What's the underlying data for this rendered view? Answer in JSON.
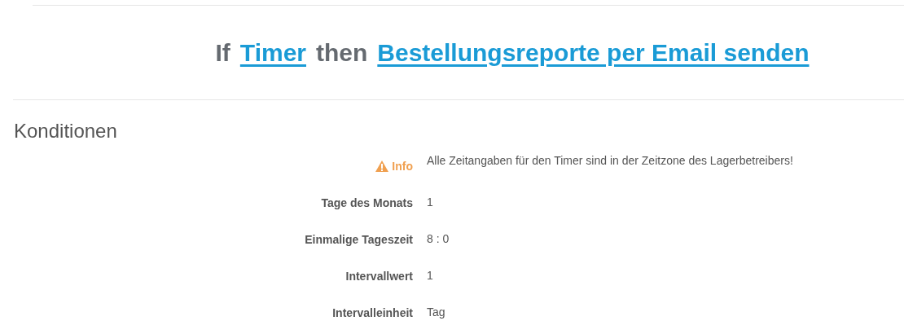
{
  "heading": {
    "parts": [
      {
        "kind": "text",
        "text": "If"
      },
      {
        "kind": "link",
        "text": "Timer"
      },
      {
        "kind": "text",
        "text": "then"
      },
      {
        "kind": "link",
        "text": "Bestellungsreporte per Email senden"
      }
    ]
  },
  "section": {
    "title": "Konditionen",
    "rows": [
      {
        "kind": "info",
        "label": "Info",
        "value": "Alle Zeitangaben für den Timer sind in der Zeitzone des Lagerbetreibers!"
      },
      {
        "kind": "field",
        "label": "Tage des Monats",
        "value": "1"
      },
      {
        "kind": "field",
        "label": "Einmalige Tageszeit",
        "value": "8 : 0"
      },
      {
        "kind": "field",
        "label": "Intervallwert",
        "value": "1"
      },
      {
        "kind": "field",
        "label": "Intervalleinheit",
        "value": "Tag"
      }
    ]
  }
}
